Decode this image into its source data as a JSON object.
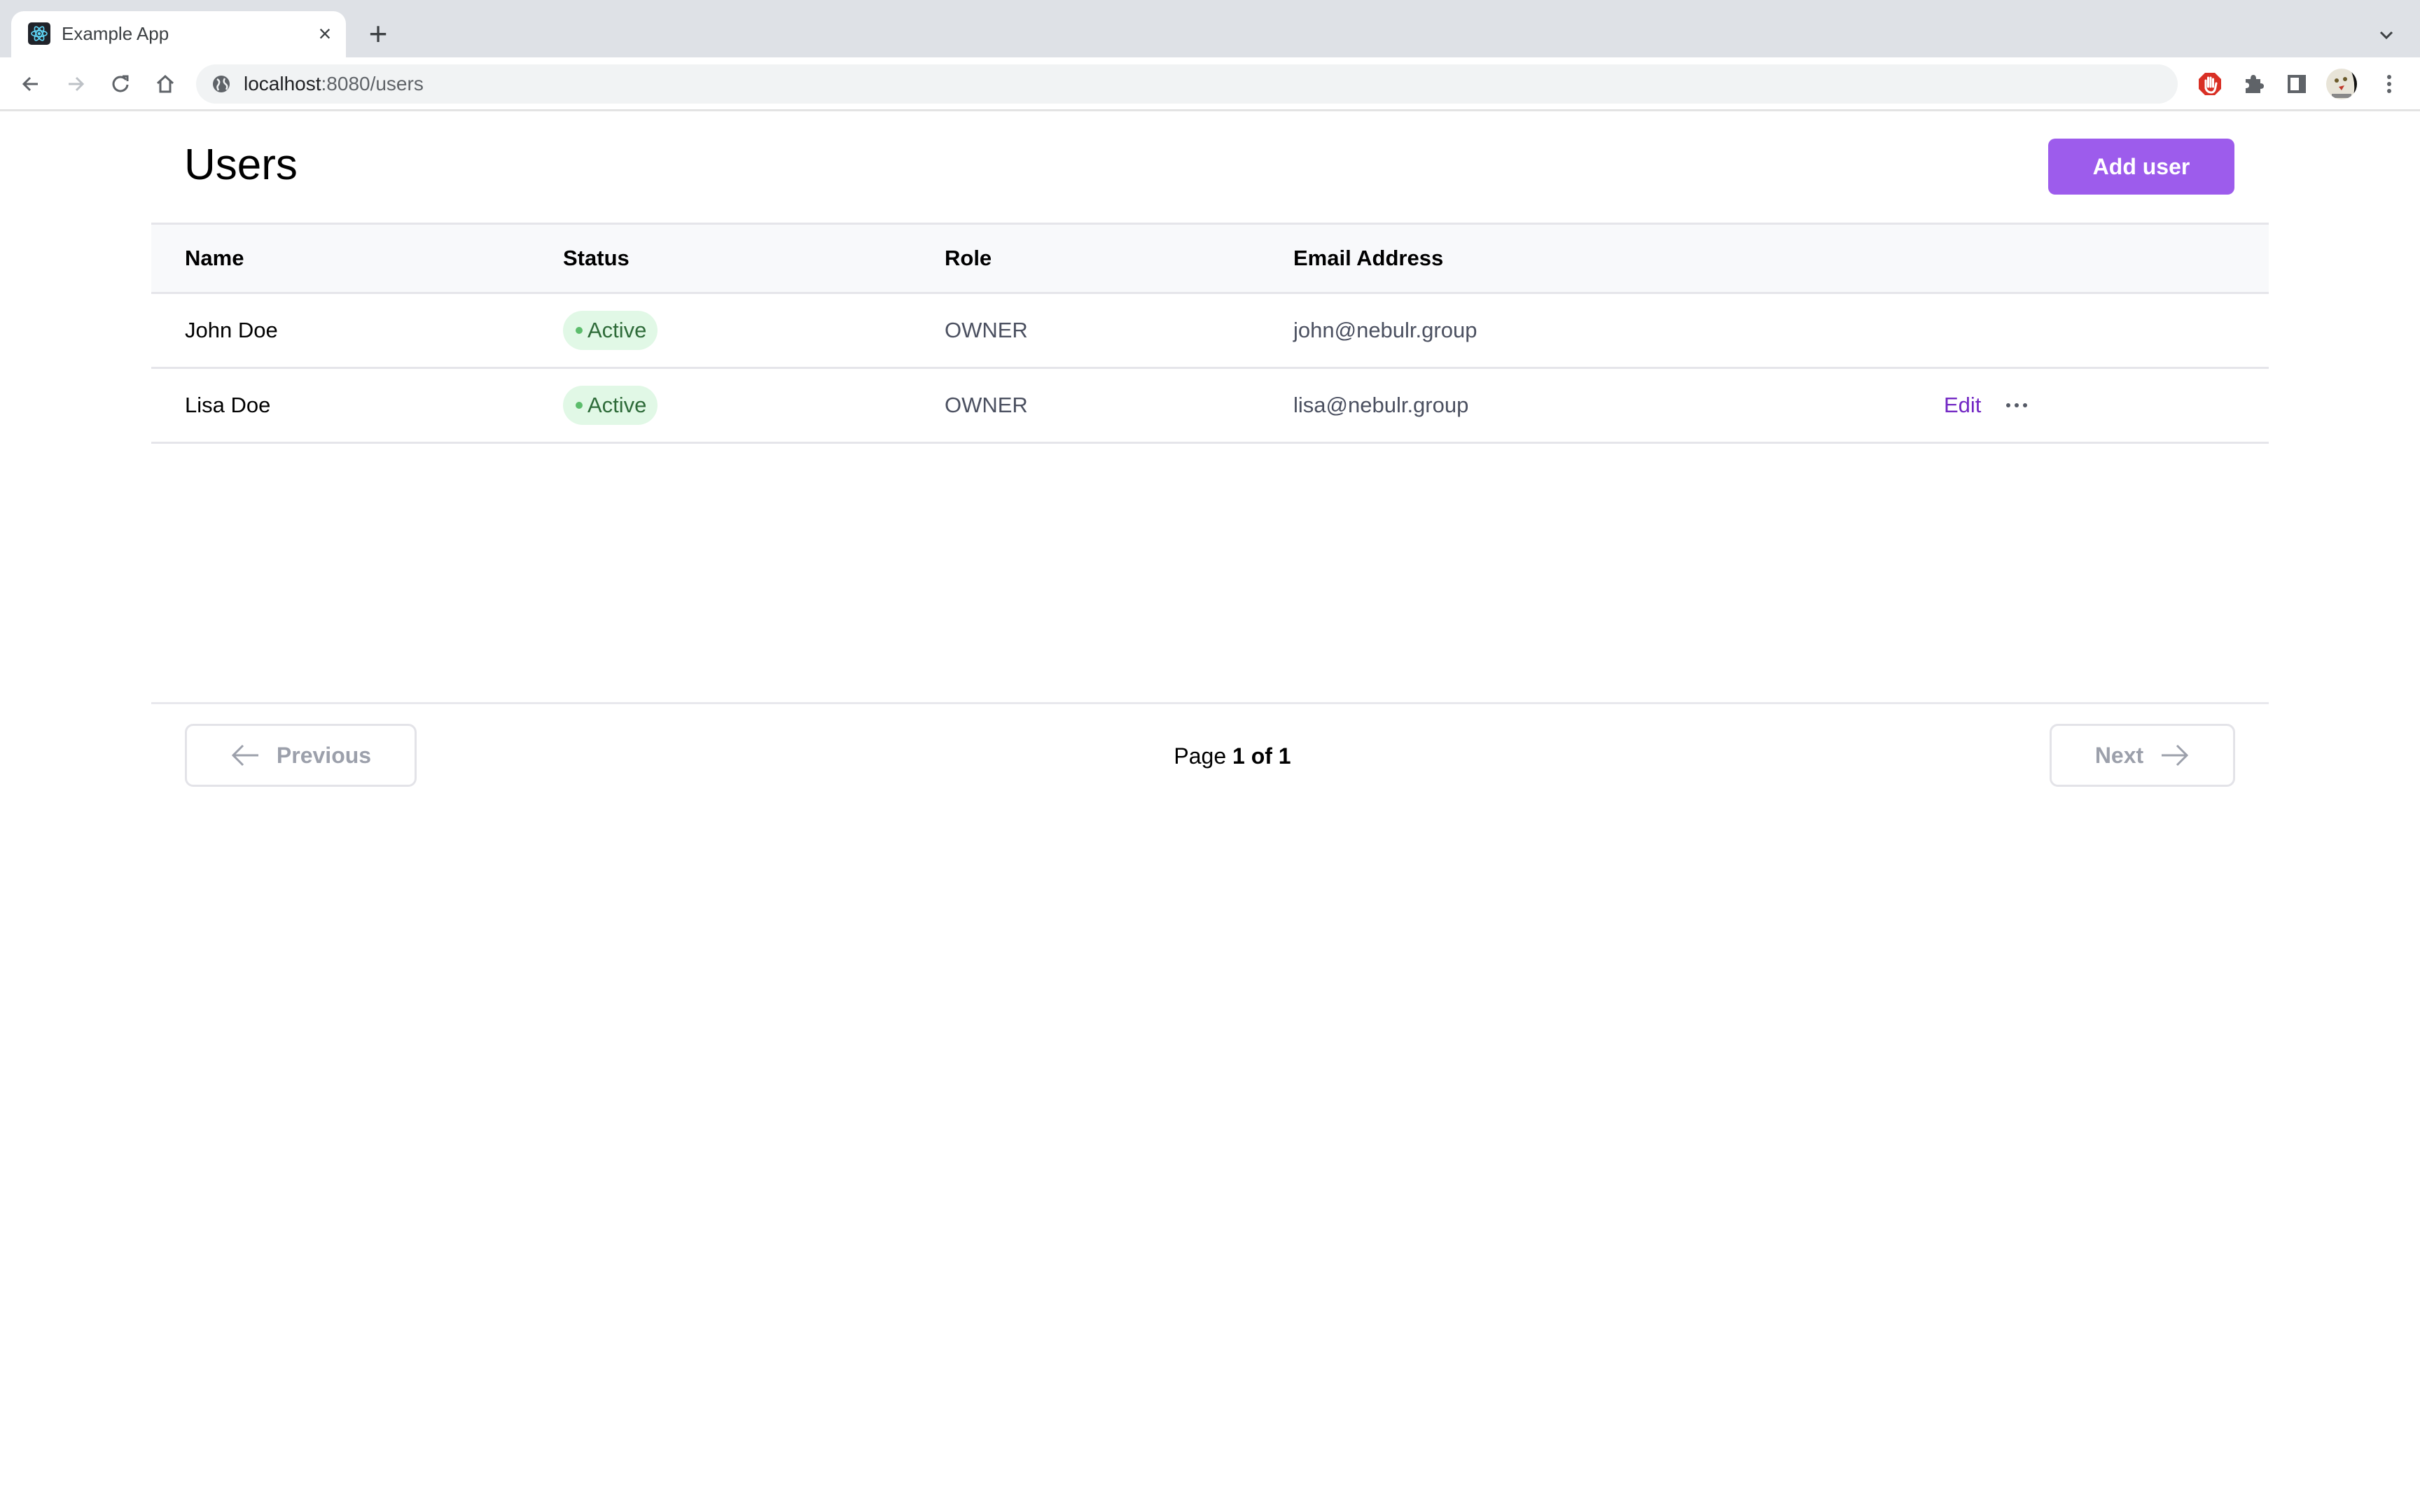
{
  "browser": {
    "tab_title": "Example App",
    "favicon": "react-atom-icon",
    "url_host": "localhost",
    "url_rest": ":8080/users",
    "extensions": [
      "adblock-icon",
      "puzzle-extensions-icon",
      "side-panel-icon",
      "profile-avatar",
      "kebab-menu-icon"
    ]
  },
  "page": {
    "title": "Users",
    "add_user_label": "Add user"
  },
  "table": {
    "columns": [
      "Name",
      "Status",
      "Role",
      "Email Address"
    ],
    "rows": [
      {
        "name": "John Doe",
        "status": "Active",
        "role": "OWNER",
        "email": "john@nebulr.group",
        "actions": []
      },
      {
        "name": "Lisa Doe",
        "status": "Active",
        "role": "OWNER",
        "email": "lisa@nebulr.group",
        "actions": [
          "Edit",
          "more"
        ]
      }
    ],
    "edit_label": "Edit"
  },
  "pagination": {
    "previous_label": "Previous",
    "next_label": "Next",
    "page_prefix": "Page",
    "current_page": "1",
    "of_label": "of",
    "total_pages": "1"
  },
  "colors": {
    "primary": "#9d5cec",
    "link": "#7328c4",
    "badge_bg": "#e1f8e6",
    "badge_text": "#2e6b39",
    "badge_dot": "#5cbd6c"
  }
}
